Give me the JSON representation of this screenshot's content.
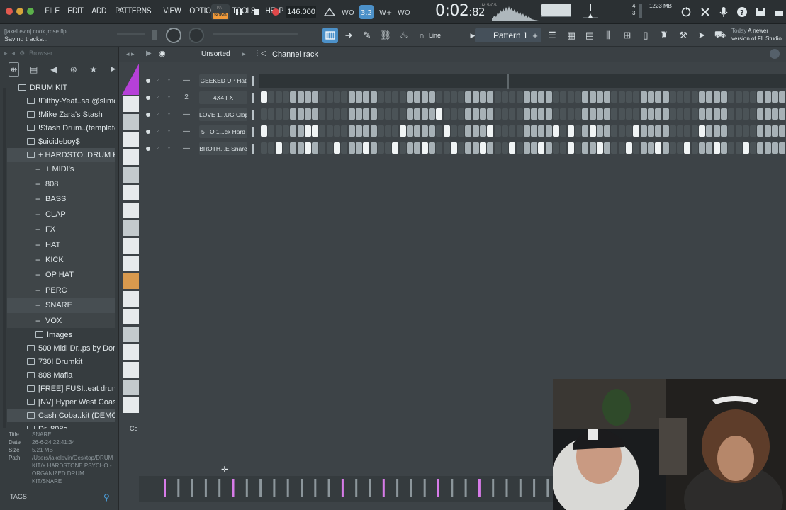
{
  "menu": [
    "FILE",
    "EDIT",
    "ADD",
    "PATTERNS",
    "VIEW",
    "OPTIONS",
    "TOOLS",
    "HELP"
  ],
  "transport": {
    "mode_top": "PAT",
    "mode_song": "SONG",
    "tempo": "146.000",
    "time_main": "0:02",
    "time_frac": "82",
    "time_label": "M:S:CS"
  },
  "cpu": {
    "memory": "1223 MB",
    "value_a": "4",
    "value_b": "3"
  },
  "project": {
    "title": "[jakeLevin] cook jrose.flp",
    "status": "Saving tracks..."
  },
  "toolbar2": {
    "snap_mode": "Line",
    "pattern": "Pattern 1"
  },
  "news": {
    "date": "Today",
    "text_1": "A newer",
    "text_2": "version of FL Studio"
  },
  "browser": {
    "header": "Browser",
    "tree": [
      {
        "label": "DRUM KIT",
        "level": 0
      },
      {
        "label": "!Filthy-Yeat..sa @slimejax",
        "level": 1
      },
      {
        "label": "!Mike Zara's Stash",
        "level": 1
      },
      {
        "label": "!Stash Drum..(template)",
        "level": 1
      },
      {
        "label": "$uicideboy$",
        "level": 1
      },
      {
        "label": "+ HARDSTO..DRUM KIT",
        "level": 1,
        "highlight": true
      }
    ],
    "subfolders": [
      "+ MIDI's",
      "808",
      "BASS",
      "CLAP",
      "FX",
      "HAT",
      "KICK",
      "OP HAT",
      "PERC",
      "SNARE",
      "VOX"
    ],
    "selected_subfolder": "SNARE",
    "tree_after": [
      {
        "label": "Images",
        "level": 1,
        "indent": 2
      },
      {
        "label": "500 Midi Dr..ps by Donit",
        "level": 1
      },
      {
        "label": "730! Drumkit",
        "level": 1
      },
      {
        "label": "808 Mafia",
        "level": 1
      },
      {
        "label": "[FREE] FUSI..eat drumkit",
        "level": 1
      },
      {
        "label": "[NV] Hyper West Coast",
        "level": 1
      },
      {
        "label": "Cash Coba..kit (DEMO)",
        "level": 1,
        "highlight": true
      },
      {
        "label": "Dr. 808s",
        "level": 1
      }
    ],
    "info": [
      {
        "k": "Title",
        "v": "SNARE"
      },
      {
        "k": "Date",
        "v": "26-6-24 22:41:34"
      },
      {
        "k": "Size",
        "v": "5.21 MB"
      },
      {
        "k": "Path",
        "v": "/Users/jakelevin/Desktop/DRUM KIT/+ HARDSTONE PSYCHO - ORGANIZED DRUM KIT/SNARE"
      }
    ],
    "tags": "TAGS"
  },
  "rack": {
    "filter": "Unsorted",
    "title": "Channel rack",
    "footer": "Co",
    "channels": [
      {
        "name": "GEEKED UP Hat",
        "num": "—",
        "steps": []
      },
      {
        "name": "4X4 FX",
        "num": "2",
        "steps": [
          0
        ]
      },
      {
        "name": "LOVE 1...UG Clap",
        "num": "—",
        "steps": [
          24
        ]
      },
      {
        "name": "5 TO 1...ck Hard",
        "num": "—",
        "steps": [
          0,
          6,
          7,
          19,
          25,
          31,
          40,
          42,
          45,
          51,
          60
        ]
      },
      {
        "name": "BROTH...E Snare",
        "num": "—",
        "steps": [
          2,
          6,
          10,
          14,
          18,
          22,
          26,
          30,
          34,
          38,
          42,
          46,
          50,
          54,
          58,
          62,
          66
        ]
      }
    ]
  }
}
